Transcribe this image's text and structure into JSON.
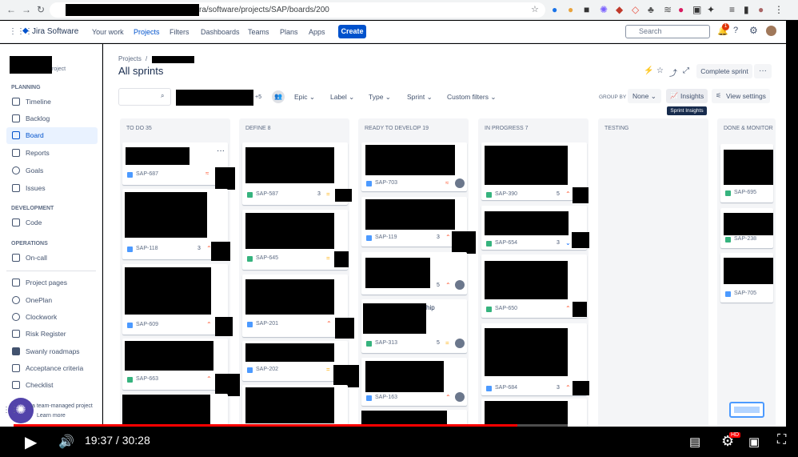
{
  "browser": {
    "url": "ra/software/projects/SAP/boards/200"
  },
  "header": {
    "logo": "Jira Software",
    "menus": [
      "Your work",
      "Projects",
      "Filters",
      "Dashboards",
      "Teams",
      "Plans",
      "Apps"
    ],
    "create": "Create",
    "search_placeholder": "Search",
    "notif_count": "1"
  },
  "sidebar": {
    "project_sub": "roject",
    "planning": "PLANNING",
    "items_planning": [
      "Timeline",
      "Backlog",
      "Board",
      "Reports",
      "Goals",
      "Issues"
    ],
    "development": "DEVELOPMENT",
    "items_dev": [
      "Code"
    ],
    "operations": "OPERATIONS",
    "items_ops": [
      "On-call"
    ],
    "items_extra": [
      "Project pages",
      "OnePlan",
      "Clockwork",
      "Risk Register",
      "Swanly roadmaps",
      "Acceptance criteria",
      "Checklist"
    ],
    "team_managed": "a team-managed project",
    "learn_more": "Learn more"
  },
  "main": {
    "breadcrumb": "Projects",
    "sep": "/",
    "title": "All sprints",
    "complete_sprint": "Complete sprint",
    "filters": {
      "avatars_more": "+5",
      "epic": "Epic",
      "label": "Label",
      "type": "Type",
      "sprint": "Sprint",
      "custom": "Custom filters",
      "group_by": "GROUP BY",
      "group_val": "None",
      "insights": "Insights",
      "view_settings": "View settings",
      "tooltip": "Sprint Insights"
    },
    "columns": [
      {
        "title": "TO DO 35",
        "cards": [
          {
            "key": "SAP-687",
            "est": ""
          },
          {
            "key": "SAP-118",
            "est": "3"
          },
          {
            "key": "SAP-609",
            "est": ""
          },
          {
            "key": "SAP-663",
            "est": ""
          }
        ]
      },
      {
        "title": "DEFINE 8",
        "cards": [
          {
            "key": "SAP-587",
            "est": "3"
          },
          {
            "key": "SAP-645",
            "est": ""
          },
          {
            "key": "SAP-201",
            "est": ""
          },
          {
            "key": "SAP-202",
            "est": ""
          }
        ]
      },
      {
        "title": "READY TO DEVELOP 19",
        "cards": [
          {
            "key": "SAP-703",
            "est": ""
          },
          {
            "key": "SAP-119",
            "est": "3"
          },
          {
            "key": "",
            "est": "5"
          },
          {
            "key": "SAP-313",
            "est": "5"
          },
          {
            "key": "SAP-163",
            "est": ""
          }
        ],
        "fragment": "hip"
      },
      {
        "title": "IN PROGRESS 7",
        "cards": [
          {
            "key": "SAP-390",
            "est": "5"
          },
          {
            "key": "SAP-654",
            "est": "3"
          },
          {
            "key": "SAP-650",
            "est": ""
          },
          {
            "key": "SAP-684",
            "est": "3"
          }
        ]
      },
      {
        "title": "TESTING",
        "cards": []
      },
      {
        "title": "DONE & MONITOR",
        "cards": [
          {
            "key": "SAP-695",
            "est": ""
          },
          {
            "key": "SAP-238",
            "est": ""
          },
          {
            "key": "SAP-705",
            "est": ""
          }
        ]
      }
    ]
  },
  "player": {
    "time": "19:37 / 30:28",
    "progress": 0.654
  }
}
